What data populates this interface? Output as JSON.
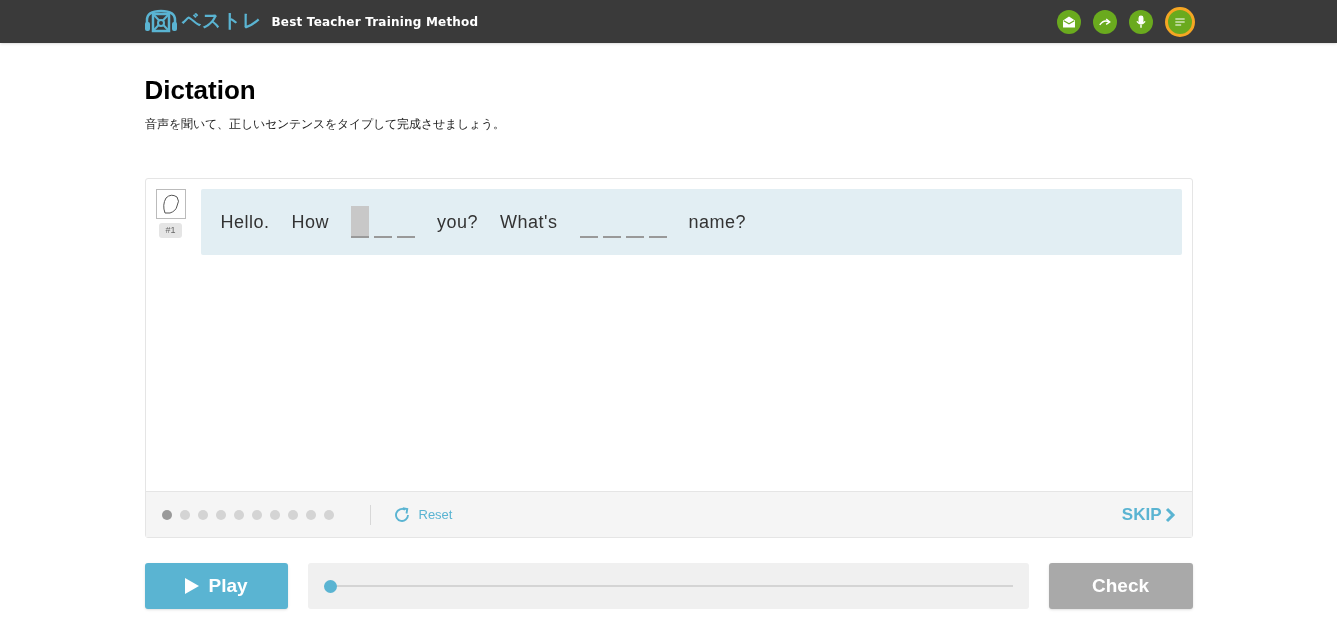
{
  "header": {
    "logo_text": "ベストレ",
    "tagline": "Best Teacher Training Method",
    "icons": [
      {
        "kind": "mail",
        "selected": false
      },
      {
        "kind": "forward",
        "selected": false
      },
      {
        "kind": "mic",
        "selected": false
      },
      {
        "kind": "list",
        "selected": true
      }
    ]
  },
  "title": "Dictation",
  "instruction": "音声を聞いて、正しいセンテンスをタイプして完成させましょう。",
  "card": {
    "speaker_number": "#1",
    "tokens": [
      {
        "kind": "word",
        "text": "Hello."
      },
      {
        "kind": "word",
        "text": "How"
      },
      {
        "kind": "blank",
        "slots": [
          {
            "active": true
          },
          {
            "active": false
          },
          {
            "active": false
          }
        ]
      },
      {
        "kind": "word",
        "text": "you?"
      },
      {
        "kind": "word",
        "text": "What's"
      },
      {
        "kind": "blank",
        "slots": [
          {
            "active": false
          },
          {
            "active": false
          },
          {
            "active": false
          },
          {
            "active": false
          }
        ]
      },
      {
        "kind": "word",
        "text": "name?"
      }
    ],
    "progress": [
      {
        "selected": true
      },
      {
        "selected": false
      },
      {
        "selected": false
      },
      {
        "selected": false
      },
      {
        "selected": false
      },
      {
        "selected": false
      },
      {
        "selected": false
      },
      {
        "selected": false
      },
      {
        "selected": false
      },
      {
        "selected": false
      }
    ],
    "reset_label": "Reset",
    "skip_label": "SKIP"
  },
  "controls": {
    "play_label": "Play",
    "audio_position": {
      "level": 0
    },
    "check_label": "Check",
    "check_disabled": true
  }
}
